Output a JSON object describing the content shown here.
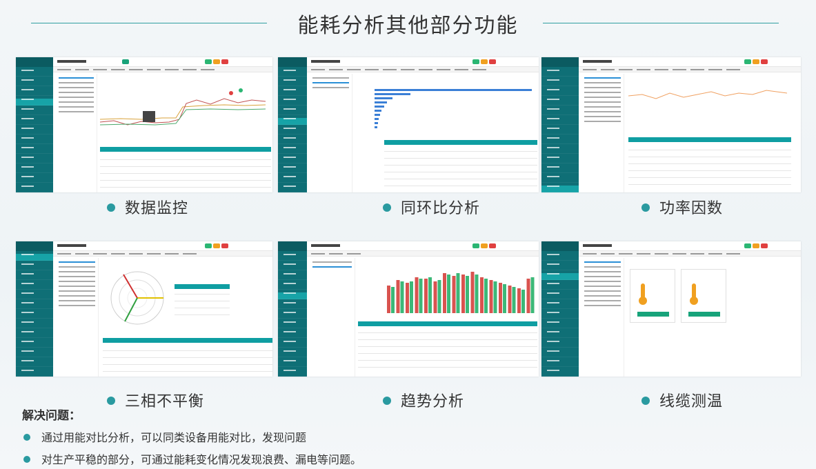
{
  "page": {
    "title": "能耗分析其他部分功能"
  },
  "panels": [
    {
      "caption": "数据监控"
    },
    {
      "caption": "同环比分析"
    },
    {
      "caption": "功率因数"
    },
    {
      "caption": "三相不平衡"
    },
    {
      "caption": "趋势分析"
    },
    {
      "caption": "线缆测温"
    }
  ],
  "solve": {
    "title": "解决问题：",
    "items": [
      "通过用能对比分析，可以同类设备用能对比，发现问题",
      "对生产平稳的部分，可通过能耗变化情况发现浪费、漏电等问题。"
    ]
  },
  "colors": {
    "accent": "#2a9aa0",
    "sidebar": "#0f6f76",
    "table_header": "#0f9ea2"
  }
}
